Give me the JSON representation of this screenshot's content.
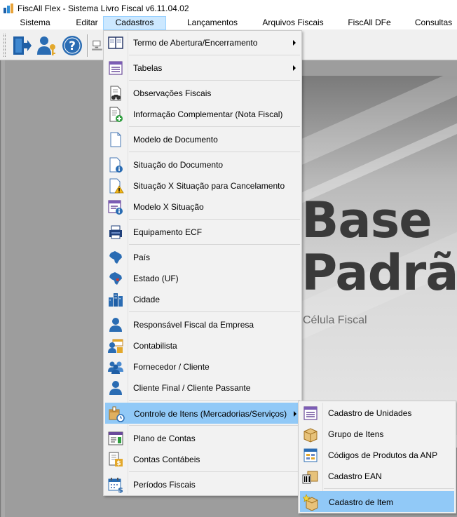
{
  "window": {
    "title": "FiscAll Flex - Sistema Livro Fiscal v6.11.04.02",
    "icon": "app-logo-icon"
  },
  "menubar": {
    "items": [
      {
        "label": "Sistema"
      },
      {
        "label": "Editar"
      },
      {
        "label": "Cadastros",
        "active": true
      },
      {
        "label": "Lançamentos"
      },
      {
        "label": "Arquivos Fiscais"
      },
      {
        "label": "FiscAll DFe"
      },
      {
        "label": "Consultas"
      }
    ]
  },
  "toolbar": {
    "buttons": [
      {
        "icon": "exit-door-icon"
      },
      {
        "icon": "user-key-icon"
      },
      {
        "icon": "help-icon"
      },
      {
        "icon": "network-computer-icon"
      }
    ]
  },
  "splash": {
    "title_line1": "Base",
    "title_line2": "Padrão",
    "subtitle": "Célula Fiscal"
  },
  "cadastros_menu": {
    "items": [
      {
        "label": "Termo de Abertura/Encerramento",
        "icon": "book-icon",
        "submenu": true
      },
      {
        "label": "Tabelas",
        "icon": "table-list-icon",
        "submenu": true
      },
      {
        "label": "Observações Fiscais",
        "icon": "document-binoculars-icon"
      },
      {
        "label": "Informação Complementar (Nota Fiscal)",
        "icon": "document-add-icon"
      },
      {
        "label": "Modelo de Documento",
        "icon": "blank-document-icon"
      },
      {
        "label": "Situação do Documento",
        "icon": "document-info-icon"
      },
      {
        "label": "Situação X Situação para Cancelamento",
        "icon": "document-warning-icon"
      },
      {
        "label": "Modelo X Situação",
        "icon": "table-info-icon"
      },
      {
        "label": "Equipamento ECF",
        "icon": "ecf-printer-icon"
      },
      {
        "label": "País",
        "icon": "brazil-map-icon"
      },
      {
        "label": "Estado (UF)",
        "icon": "brazil-state-map-icon"
      },
      {
        "label": "Cidade",
        "icon": "city-buildings-icon"
      },
      {
        "label": "Responsável Fiscal da Empresa",
        "icon": "person-icon"
      },
      {
        "label": "Contabilista",
        "icon": "accountant-icon"
      },
      {
        "label": "Fornecedor / Cliente",
        "icon": "people-group-icon"
      },
      {
        "label": "Cliente Final / Cliente Passante",
        "icon": "person-icon"
      },
      {
        "label": "Controle de Itens (Mercadorias/Serviços)",
        "icon": "item-control-icon",
        "submenu": true,
        "highlighted": true
      },
      {
        "label": "Plano de Contas",
        "icon": "chart-of-accounts-icon"
      },
      {
        "label": "Contas Contábeis",
        "icon": "accounting-book-icon"
      },
      {
        "label": "Períodos Fiscais",
        "icon": "calendar-money-icon"
      }
    ]
  },
  "itens_submenu": {
    "items": [
      {
        "label": "Cadastro de Unidades",
        "icon": "units-table-icon"
      },
      {
        "label": "Grupo de Itens",
        "icon": "box-group-icon"
      },
      {
        "label": "Códigos de Produtos da ANP",
        "icon": "anp-codes-icon"
      },
      {
        "label": "Cadastro EAN",
        "icon": "barcode-box-icon"
      },
      {
        "label": "Cadastro de Item",
        "icon": "new-item-box-icon",
        "highlighted": true
      }
    ]
  },
  "colors": {
    "menu_active_bg": "#cce8ff",
    "menu_highlight_bg": "#91c9f7",
    "menu_bg": "#f2f2f2",
    "workspace_bg": "#9d9d9d"
  }
}
